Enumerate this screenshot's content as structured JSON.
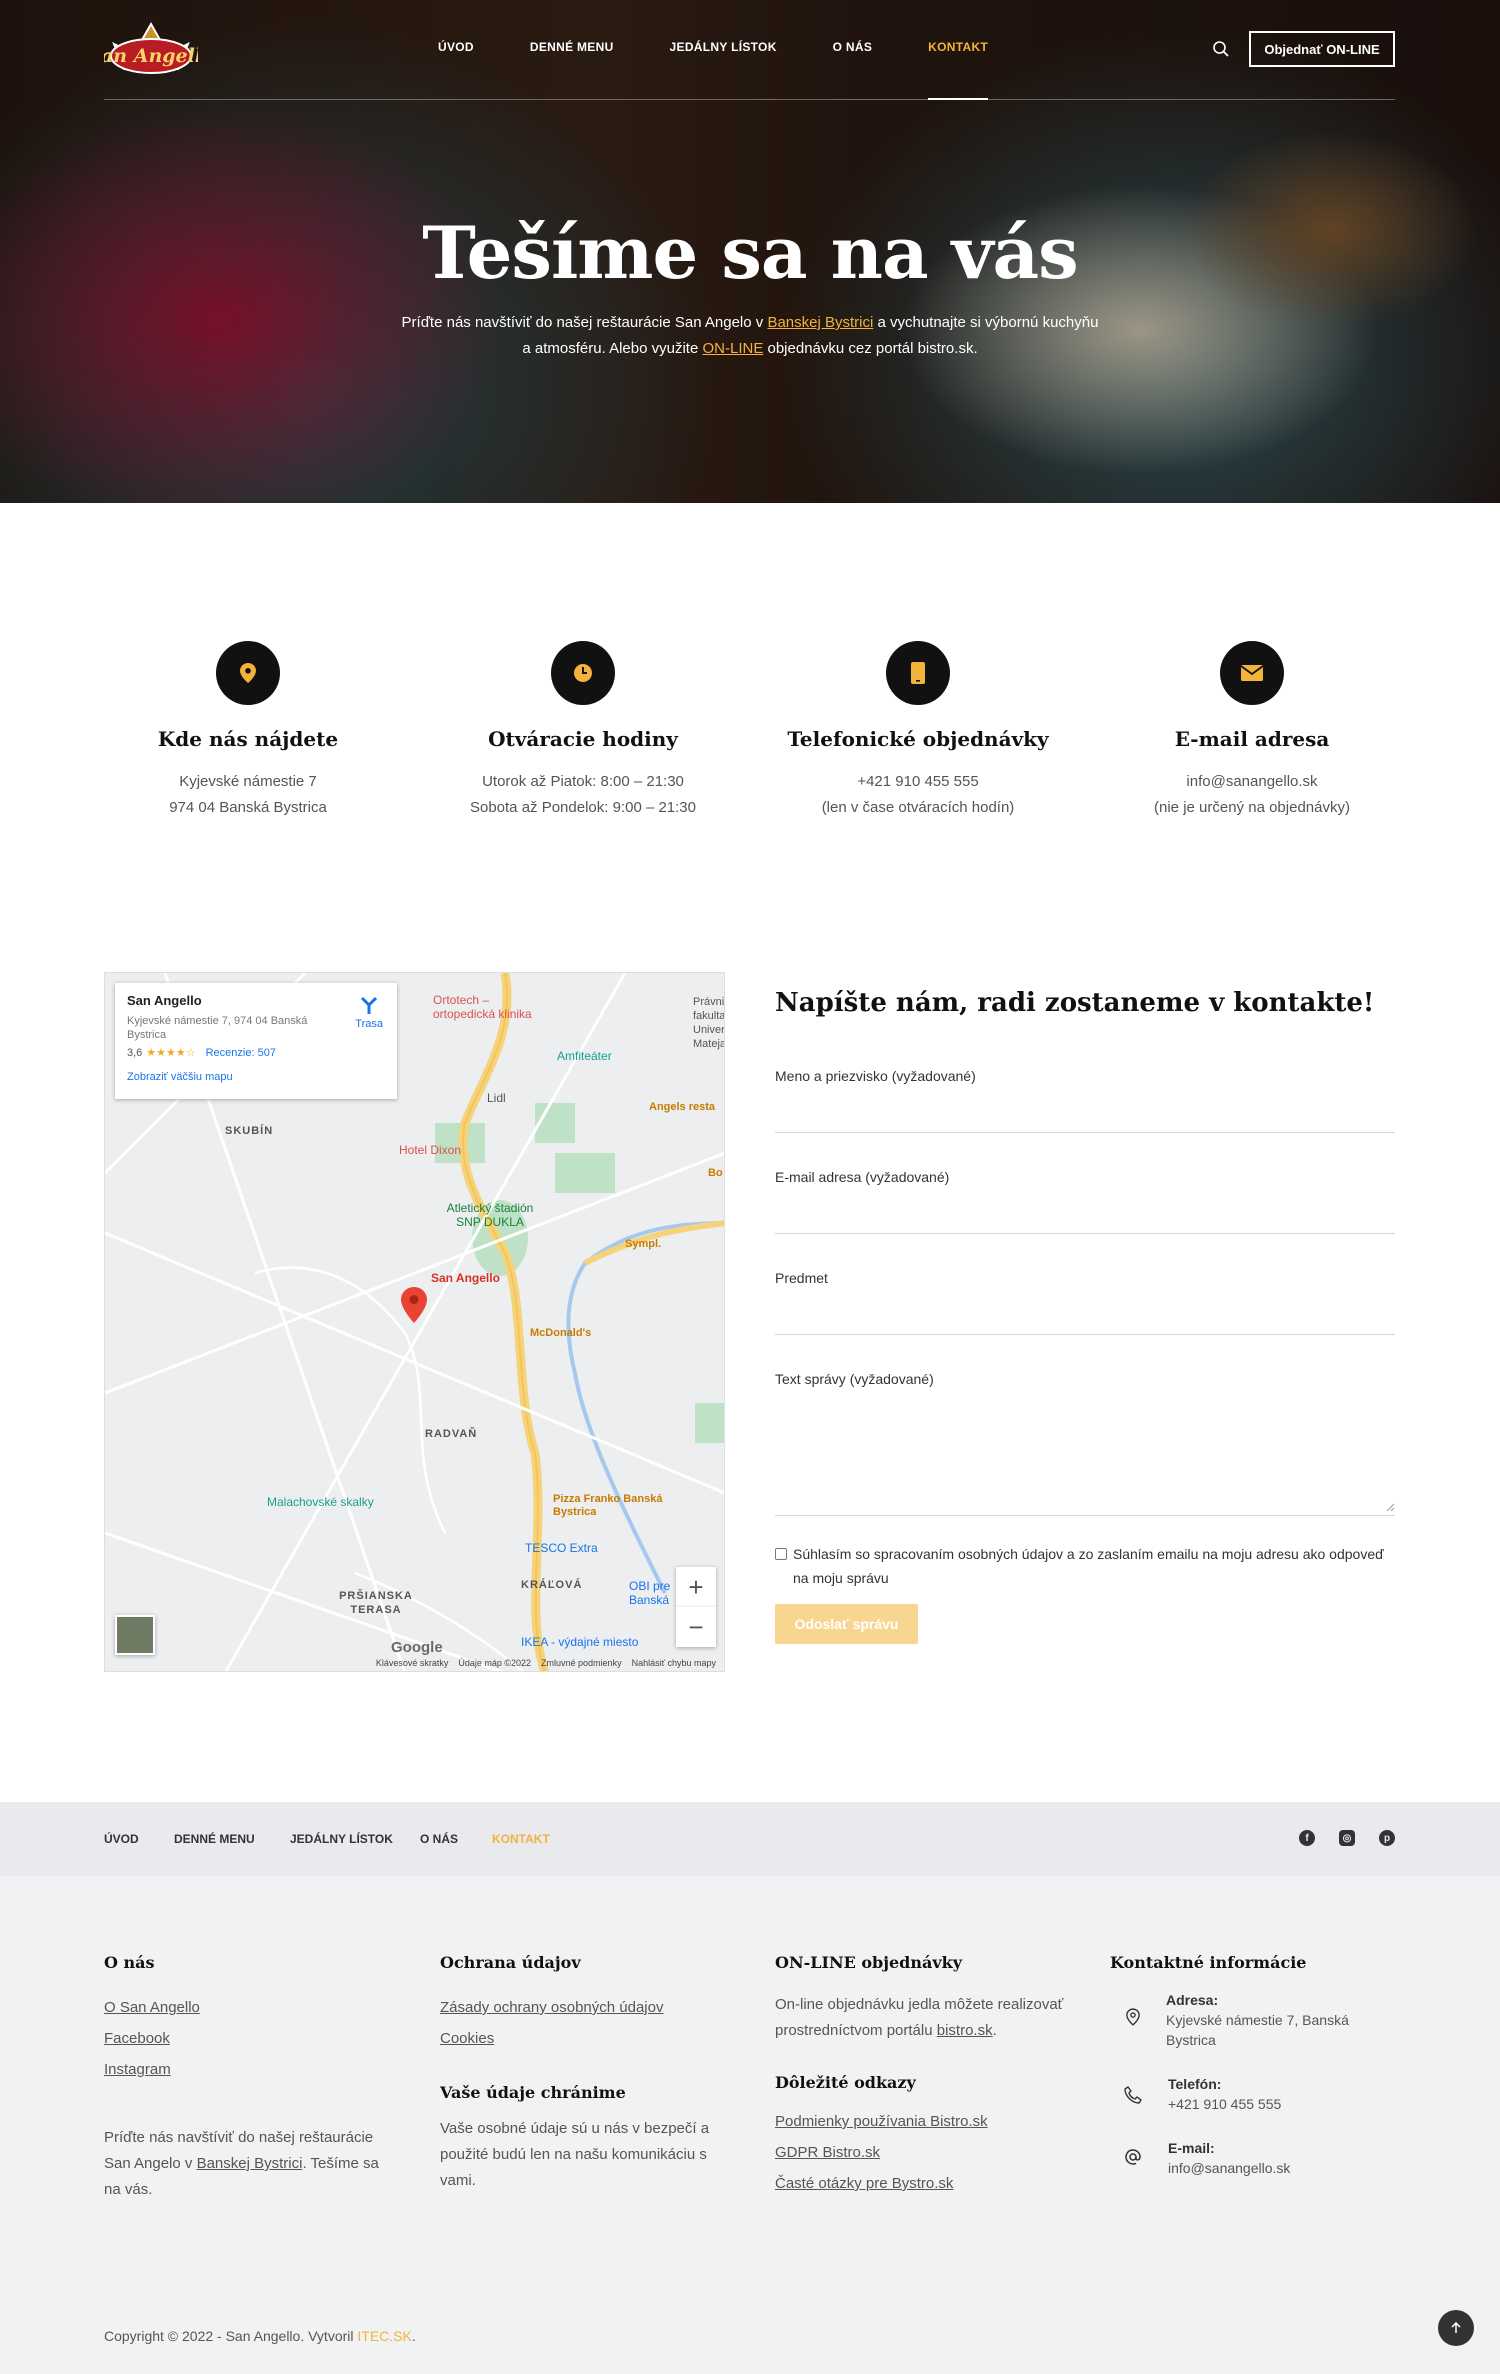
{
  "nav": {
    "items": [
      {
        "label": "ÚVOD"
      },
      {
        "label": "DENNÉ MENU"
      },
      {
        "label": "JEDÁLNY LÍSTOK"
      },
      {
        "label": "O NÁS"
      },
      {
        "label": "KONTAKT"
      }
    ],
    "active_index": 4,
    "order_button": "Objednať ON-LINE"
  },
  "brand": {
    "logo_text": "San Angello"
  },
  "hero": {
    "title": "Tešíme sa na vás",
    "text_1": "Príďte nás navštíviť do našej reštaurácie San Angelo v ",
    "link_city": "Banskej Bystrici",
    "text_2": " a vychutnajte si výbornú kuchyňu a atmosféru. Alebo využite ",
    "link_online": "ON-LINE",
    "text_3": " objednávku cez portál bistro.sk."
  },
  "features": [
    {
      "icon": "location-pin-icon",
      "title": "Kde nás nájdete",
      "line1": "Kyjevské námestie 7",
      "line2": "974 04 Banská Bystrica"
    },
    {
      "icon": "clock-icon",
      "title": "Otváracie hodiny",
      "line1": "Utorok až Piatok: 8:00 – 21:30",
      "line2": "Sobota až Pondelok: 9:00 – 21:30"
    },
    {
      "icon": "phone-icon",
      "title": "Telefonické objednávky",
      "line1": "+421 910 455 555",
      "line2": "(len v čase otváracích hodín)"
    },
    {
      "icon": "envelope-icon",
      "title": "E-mail adresa",
      "line1": "info@sanangello.sk",
      "line2": "(nie je určený na objednávky)"
    }
  ],
  "map": {
    "card": {
      "name": "San Angello",
      "address": "Kyjevské námestie 7, 974 04 Banská Bystrica",
      "rating": "3,6",
      "reviews": "Recenzie: 507",
      "route": "Trasa",
      "bigger": "Zobraziť väčšiu mapu"
    },
    "labels": [
      "Ortotech – ortopedická klinika",
      "Amfiteáter",
      "Lidl",
      "SKUBÍN",
      "Hotel Dixon",
      "Angels resta",
      "Atletický štadión SNP DUKLA",
      "Sympl.",
      "San Angello",
      "McDonald's",
      "RADVAŇ",
      "Malachovské skalky",
      "Pizza Franko Banská Bystrica",
      "TESCO Extra",
      "KRÁĽOVÁ",
      "PRŠIANSKA TERASA",
      "OBI pre Banská",
      "IKEA - výdajné miesto",
      "Právnická fakulta Univerzity Mateja",
      "Bo"
    ],
    "zoom_in": "+",
    "zoom_out": "−",
    "google": "Google",
    "footer": [
      "Klávesové skratky",
      "Údaje máp ©2022",
      "Zmluvné podmienky",
      "Nahlásiť chybu mapy"
    ]
  },
  "form": {
    "title": "Napíšte nám, radi zostaneme v kontakte!",
    "name_label": "Meno a priezvisko (vyžadované)",
    "email_label": "E-mail adresa (vyžadované)",
    "subject_label": "Predmet",
    "message_label": "Text správy (vyžadované)",
    "consent": "Súhlasím so spracovaním osobných údajov a zo zaslaním emailu na moju adresu ako odpoveď na moju správu",
    "submit": "Odoslať správu"
  },
  "footer_nav": {
    "items": [
      {
        "label": "ÚVOD"
      },
      {
        "label": "DENNÉ MENU"
      },
      {
        "label": "JEDÁLNY LÍSTOK"
      },
      {
        "label": "O NÁS"
      },
      {
        "label": "KONTAKT"
      }
    ],
    "social": [
      "facebook-icon",
      "instagram-icon",
      "pinterest-icon"
    ]
  },
  "footer": {
    "about": {
      "title": "O nás",
      "links": [
        "O San Angello",
        "Facebook",
        "Instagram"
      ],
      "text_1": "Príďte nás navštíviť do našej reštaurácie San Angelo v ",
      "link": "Banskej Bystrici",
      "text_2": ". Tešíme sa na vás."
    },
    "privacy": {
      "title": "Ochrana údajov",
      "links": [
        "Zásady ochrany osobných údajov",
        "Cookies"
      ],
      "sub_title": "Vaše údaje chránime",
      "text": "Vaše osobné údaje sú u nás v bezpečí a použité budú len na našu komunikáciu s vami."
    },
    "online": {
      "title": "ON-LINE objednávky",
      "text": "On-line objednávku jedla môžete realizovať prostredníctvom portálu ",
      "link": "bistro.sk",
      "tail": ".",
      "sub_title": "Dôležité odkazy",
      "links": [
        "Podmienky používania Bistro.sk",
        "GDPR Bistro.sk",
        "Časté otázky pre Bystro.sk"
      ]
    },
    "contact": {
      "title": "Kontaktné informácie",
      "address_label": "Adresa:",
      "address": "Kyjevské námestie 7, Banská Bystrica",
      "phone_label": "Telefón:",
      "phone": "+421 910 455 555",
      "email_label": "E-mail:",
      "email": "info@sanangello.sk"
    }
  },
  "copyright": {
    "text": "Copyright © 2022 - San Angello. Vytvoril ",
    "link": "ITEC.SK",
    "tail": "."
  },
  "colors": {
    "accent": "#f3b23b",
    "dark": "#111111",
    "footer_bg": "#f1f2f4",
    "footer_nav_bg": "#e9eaed",
    "submit_bg": "#f8d690"
  }
}
